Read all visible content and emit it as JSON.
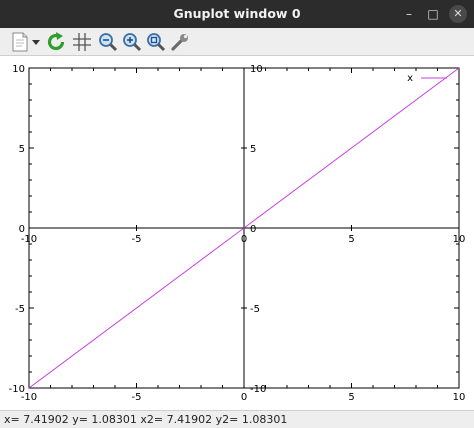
{
  "window": {
    "title": "Gnuplot window 0",
    "minimize_glyph": "–",
    "maximize_glyph": "□",
    "close_glyph": "✕"
  },
  "toolbar": {
    "items": [
      {
        "icon": "export-document-icon"
      },
      {
        "icon": "dropdown-arrow-icon"
      },
      {
        "icon": "replot-icon"
      },
      {
        "icon": "grid-icon"
      },
      {
        "icon": "zoom-out-icon"
      },
      {
        "icon": "zoom-in-icon"
      },
      {
        "icon": "zoom-reset-icon"
      },
      {
        "icon": "settings-wrench-icon"
      }
    ]
  },
  "status": {
    "text": "x= 7.41902 y= 1.08301 x2= 7.41902 y2= 1.08301"
  },
  "colors": {
    "series": "#c840e0",
    "titlebar": "#2c2c2c"
  },
  "chart_data": {
    "type": "line",
    "title": "",
    "xlabel": "",
    "ylabel": "",
    "xlim": [
      -10,
      10
    ],
    "ylim": [
      -10,
      10
    ],
    "grid": false,
    "zero_axes": true,
    "legend_position": "top-right",
    "x_ticks": [
      -10,
      -5,
      0,
      5,
      10
    ],
    "y_ticks": [
      -10,
      -5,
      0,
      5,
      10
    ],
    "series": [
      {
        "name": "x",
        "x": [
          -10,
          10
        ],
        "y": [
          -10,
          10
        ],
        "color": "#c840e0"
      }
    ]
  }
}
